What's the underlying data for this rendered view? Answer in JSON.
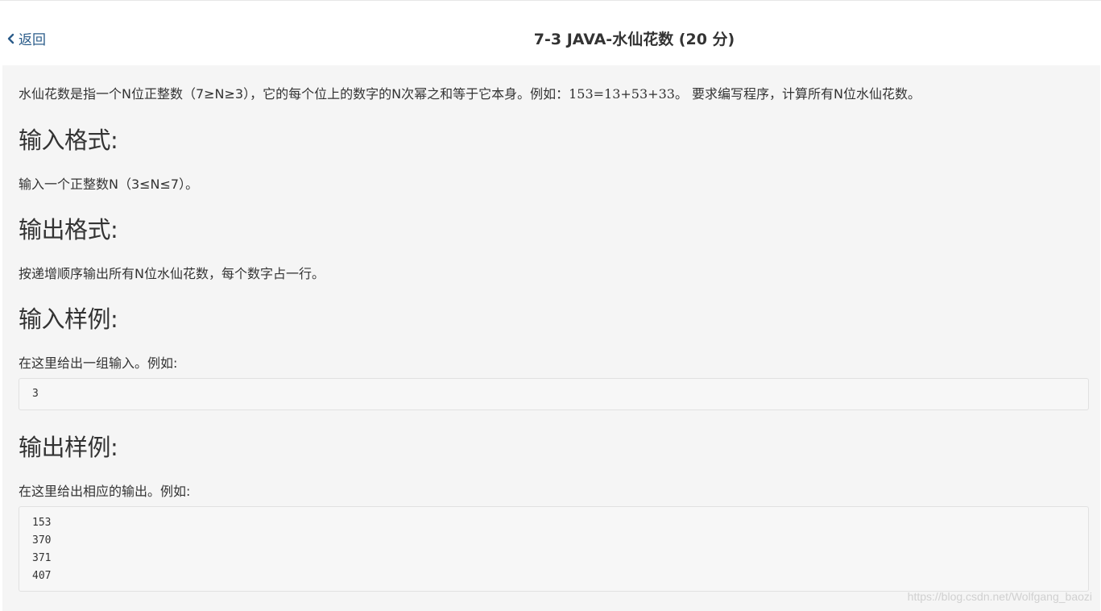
{
  "header": {
    "back_label": "返回",
    "title": "7-3 JAVA-水仙花数 (20 分)"
  },
  "problem": {
    "description_pre": "水仙花数是指一个N位正整数（7≥N≥3），它的每个位上的数字的N次幂之和等于它本身。例如：",
    "description_math": "153=13+53+33",
    "description_post": "。 要求编写程序，计算所有N位水仙花数。",
    "input_format_heading": "输入格式:",
    "input_format_text": "输入一个正整数N（3≤N≤7）。",
    "output_format_heading": "输出格式:",
    "output_format_text": "按递增顺序输出所有N位水仙花数，每个数字占一行。",
    "sample_input_heading": "输入样例:",
    "sample_input_intro": "在这里给出一组输入。例如:",
    "sample_input_lines": [
      "3"
    ],
    "sample_output_heading": "输出样例:",
    "sample_output_intro": "在这里给出相应的输出。例如:",
    "sample_output_lines": [
      "153",
      "370",
      "371",
      "407"
    ]
  },
  "watermark": "https://blog.csdn.net/Wolfgang_baozi",
  "colors": {
    "link": "#2b5c8a",
    "content_bg": "#f5f5f5",
    "code_bg": "#f7f7f7",
    "text": "#333333"
  }
}
